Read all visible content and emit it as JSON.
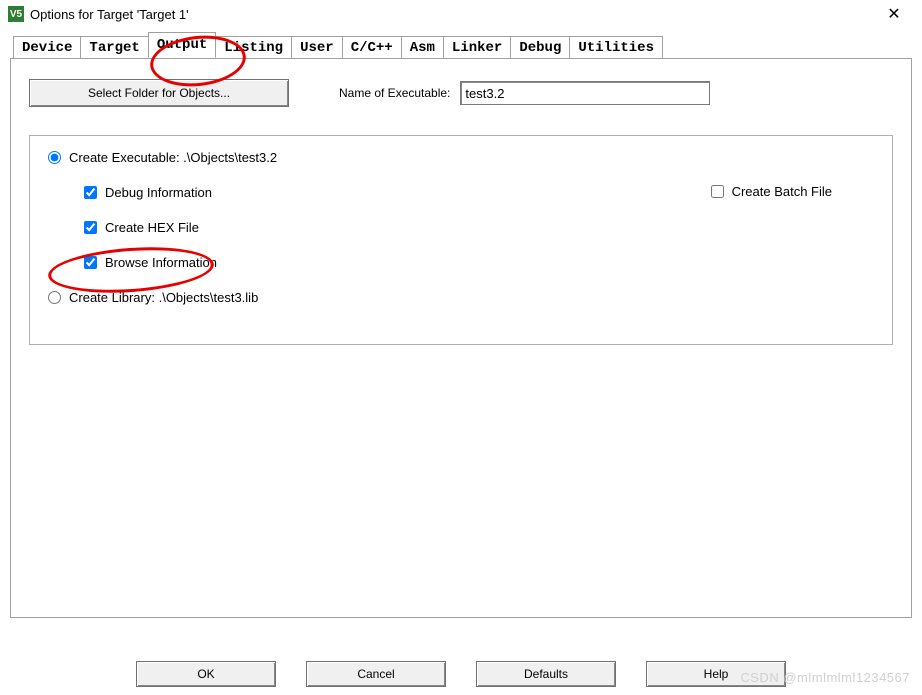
{
  "title": "Options for Target 'Target 1'",
  "app_icon_text": "V5",
  "tabs": [
    "Device",
    "Target",
    "Output",
    "Listing",
    "User",
    "C/C++",
    "Asm",
    "Linker",
    "Debug",
    "Utilities"
  ],
  "active_tab_index": 2,
  "top": {
    "select_folder_label": "Select Folder for Objects...",
    "name_label": "Name of Executable:",
    "name_value": "test3.2"
  },
  "group": {
    "create_exec_label": "Create Executable:  .\\Objects\\test3.2",
    "debug_info_label": "Debug Information",
    "create_hex_label": "Create HEX File",
    "browse_info_label": "Browse Information",
    "create_lib_label": "Create Library:  .\\Objects\\test3.lib",
    "create_batch_label": "Create Batch File",
    "debug_info_checked": true,
    "create_hex_checked": true,
    "browse_info_checked": true,
    "batch_checked": false,
    "radio_selected": "exec"
  },
  "buttons": {
    "ok": "OK",
    "cancel": "Cancel",
    "defaults": "Defaults",
    "help": "Help"
  },
  "watermark": "CSDN @mlmlmlml1234567"
}
